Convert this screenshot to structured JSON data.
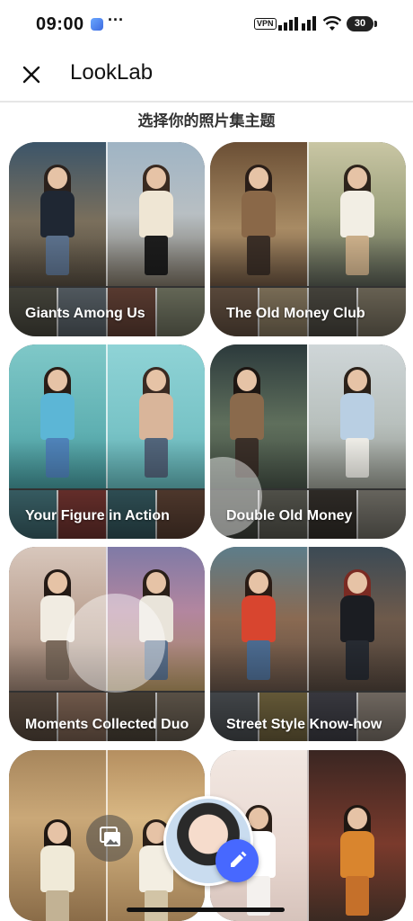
{
  "status_bar": {
    "time": "09:00",
    "more": "···",
    "vpn": "VPN",
    "battery": "30",
    "icons": [
      "app-notification-icon",
      "signal-icon",
      "wifi-icon",
      "battery-icon"
    ]
  },
  "app_bar": {
    "title": "LookLab",
    "close_icon": "close-icon"
  },
  "section_title": "选择你的照片集主题",
  "themes": [
    {
      "label": "Giants Among Us"
    },
    {
      "label": "The Old Money Club"
    },
    {
      "label": "Your Figure in Action"
    },
    {
      "label": "Double Old Money"
    },
    {
      "label": "Moments Collected Duo"
    },
    {
      "label": "Street Style Know-how"
    },
    {
      "label": ""
    },
    {
      "label": ""
    }
  ],
  "floating_actions": {
    "gallery_icon": "gallery-icon",
    "avatar": "user-avatar",
    "edit_icon": "pencil-icon"
  },
  "colors": {
    "accent": "#4768ff",
    "background": "#ffffff",
    "text": "#111111"
  }
}
